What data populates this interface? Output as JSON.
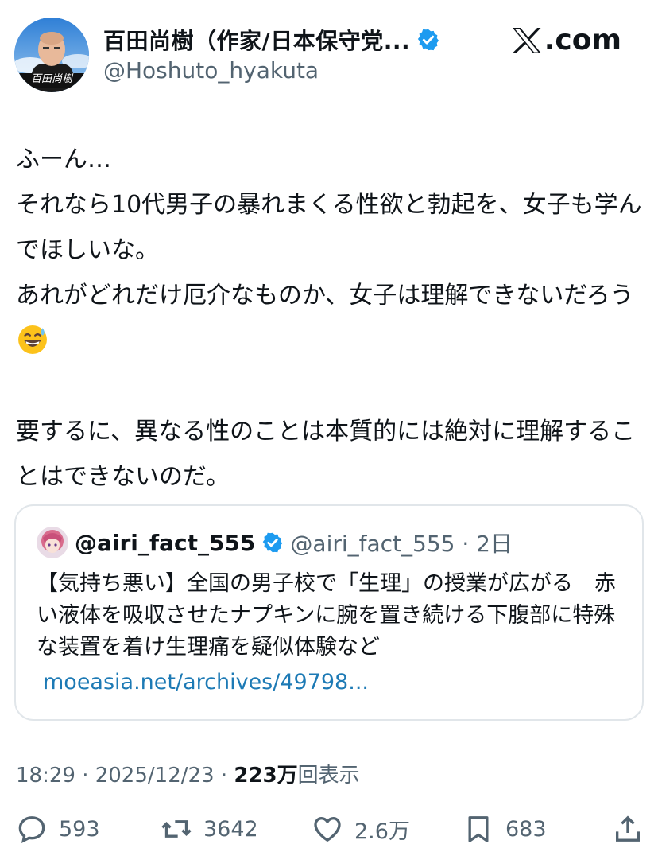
{
  "author": {
    "display_name": "百田尚樹（作家/日本保守党...",
    "handle": "@Hoshuto_hyakuta",
    "avatar_caption": "百田尚樹"
  },
  "site": {
    "logo_text": ".com"
  },
  "tweet": {
    "text": "ふーん…\nそれなら10代男子の暴れまくる性欲と勃起を、女子も学んでほしいな。\nあれがどれだけ厄介なものか、女子は理解できないだろう",
    "emoji": "grinning-sweat-emoji",
    "text2": "\n\n要するに、異なる性のことは本質的には絶対に理解することはできないのだ。"
  },
  "quote": {
    "name": "@airi_fact_555",
    "handle_time": "@airi_fact_555 · 2日",
    "text": "【気持ち悪い】全国の男子校で「生理」の授業が広がる　赤い液体を吸収させたナプキンに腕を置き続ける下腹部に特殊な装置を着け生理痛を疑似体験など",
    "link": "moeasia.net/archives/49798..."
  },
  "meta": {
    "time_date": "18:29 · 2025/12/23 · ",
    "views_count": "223万",
    "views_label": "回表示"
  },
  "actions": {
    "replies": "593",
    "reposts": "3642",
    "likes": "2.6万",
    "bookmarks": "683"
  },
  "colors": {
    "verified": "#1d9bf0",
    "link": "#1d7ab5",
    "secondary_text": "#536471"
  }
}
